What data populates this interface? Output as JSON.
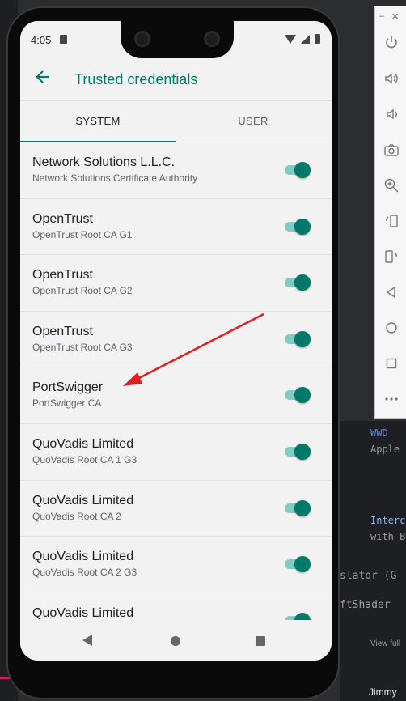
{
  "status_bar": {
    "time": "4:05"
  },
  "app_bar": {
    "title": "Trusted credentials"
  },
  "tabs": [
    {
      "label": "SYSTEM",
      "selected": true
    },
    {
      "label": "USER",
      "selected": false
    }
  ],
  "certificates": [
    {
      "org": "Network Solutions L.L.C.",
      "name": "Network Solutions Certificate Authority",
      "enabled": true
    },
    {
      "org": "OpenTrust",
      "name": "OpenTrust Root CA G1",
      "enabled": true
    },
    {
      "org": "OpenTrust",
      "name": "OpenTrust Root CA G2",
      "enabled": true
    },
    {
      "org": "OpenTrust",
      "name": "OpenTrust Root CA G3",
      "enabled": true
    },
    {
      "org": "PortSwigger",
      "name": "PortSwigger CA",
      "enabled": true
    },
    {
      "org": "QuoVadis Limited",
      "name": "QuoVadis Root CA 1 G3",
      "enabled": true
    },
    {
      "org": "QuoVadis Limited",
      "name": "QuoVadis Root CA 2",
      "enabled": true
    },
    {
      "org": "QuoVadis Limited",
      "name": "QuoVadis Root CA 2 G3",
      "enabled": true
    },
    {
      "org": "QuoVadis Limited",
      "name": "",
      "enabled": true
    }
  ],
  "background_text": {
    "line1": "slator (G",
    "line2": "ftShader",
    "line3": "Jimmy",
    "line4": "View full",
    "line5": "Interc",
    "line6": "with B",
    "line7": "WWD",
    "line8": "Apple"
  },
  "colors": {
    "accent": "#00796b",
    "switch_track": "#80cbc4",
    "annotation": "#e02020"
  },
  "emulator_toolbar": {
    "icons": [
      "power-icon",
      "volume-up-icon",
      "volume-down-icon",
      "camera-icon",
      "zoom-icon",
      "rotate-left-icon",
      "rotate-right-icon",
      "back-icon",
      "home-icon",
      "overview-icon",
      "more-icon"
    ]
  }
}
